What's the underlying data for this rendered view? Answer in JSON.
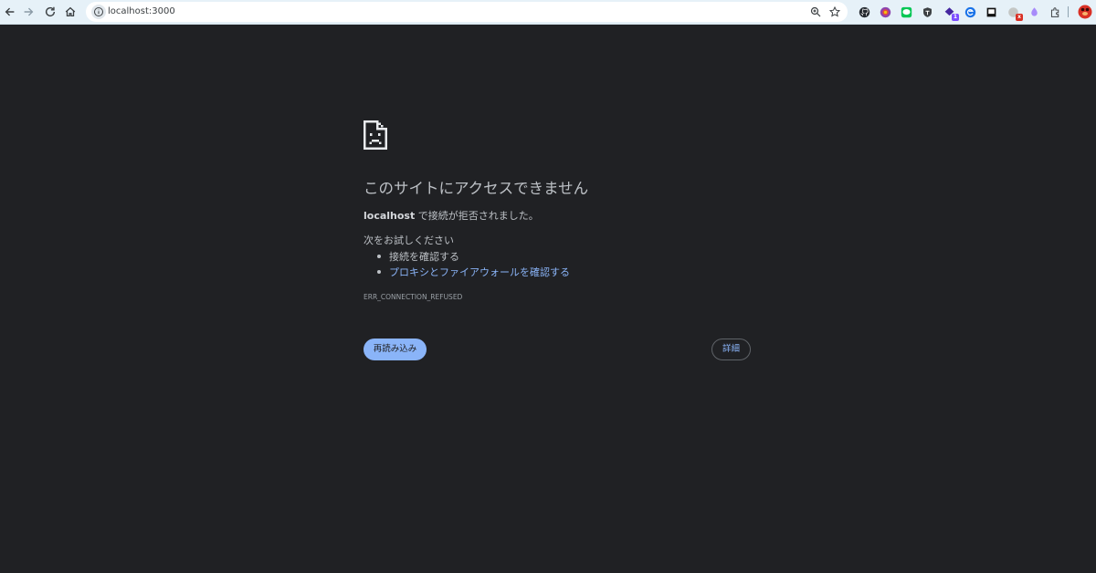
{
  "browser": {
    "url": "localhost:3000",
    "toolbar_bg": "#e6f1f8",
    "nav": [
      "back-icon",
      "forward-icon",
      "reload-icon",
      "home-icon"
    ],
    "omnibox_actions": [
      "zoom-icon",
      "bookmark-star-icon"
    ],
    "extensions": [
      {
        "name": "github-icon",
        "color": "#24292f",
        "badge": ""
      },
      {
        "name": "chrome-ext-icon",
        "color": "#8e44ad",
        "badge": ""
      },
      {
        "name": "line-icon",
        "color": "#06c755",
        "badge": ""
      },
      {
        "name": "shield-ext-icon",
        "color": "#3c4043",
        "badge": ""
      },
      {
        "name": "puzzle-badge-ext-icon",
        "color": "#4527a0",
        "badge": "1"
      },
      {
        "name": "edge-ext-icon",
        "color": "#1a73e8",
        "badge": ""
      },
      {
        "name": "square-ext-icon",
        "color": "#111111",
        "badge": ""
      },
      {
        "name": "gray-ext-icon",
        "color": "#9aa0a6",
        "badge": "x"
      },
      {
        "name": "crystal-ext-icon",
        "color": "#a78bfa",
        "badge": ""
      },
      {
        "name": "extensions-puzzle-icon",
        "color": "#3c4043",
        "badge": ""
      },
      {
        "name": "profile-avatar-icon",
        "color": "#d93025",
        "badge": ""
      }
    ]
  },
  "error": {
    "icon": "sad-document-icon",
    "title": "このサイトにアクセスできません",
    "host": "localhost",
    "description_suffix": " で接続が拒否されました。",
    "suggestions_title": "次をお試しください",
    "suggestions": [
      "接続を確認する",
      "プロキシとファイアウォールを確認する"
    ],
    "code": "ERR_CONNECTION_REFUSED",
    "reload_label": "再読み込み",
    "details_label": "詳細"
  },
  "colors": {
    "page_bg": "#202124",
    "text": "#bdc1c6",
    "link": "#8ab4f8",
    "button_bg": "#8ab4f8"
  }
}
